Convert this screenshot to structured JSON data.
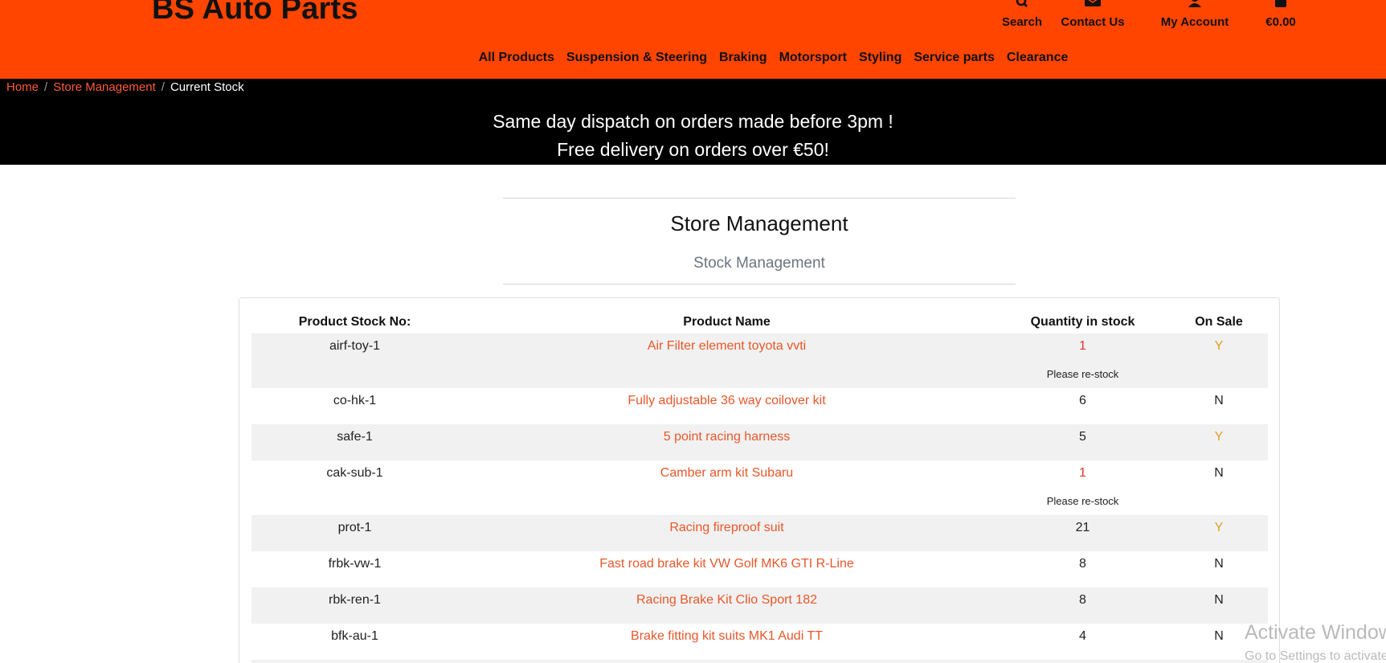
{
  "brand": "BS Auto Parts",
  "account_nav": [
    {
      "label": "Search",
      "icon": "search-icon"
    },
    {
      "label": "Contact Us",
      "icon": "envelope-icon"
    },
    {
      "label": "My Account",
      "icon": "user-icon"
    },
    {
      "label": "€0.00",
      "icon": "shopping-bag-icon"
    }
  ],
  "main_nav": [
    "All Products",
    "Suspension & Steering",
    "Braking",
    "Motorsport",
    "Styling",
    "Service parts",
    "Clearance"
  ],
  "breadcrumb": {
    "home": "Home",
    "section": "Store Management",
    "current": "Current Stock"
  },
  "banner": {
    "line1": "Same day dispatch on orders made before 3pm !",
    "line2": "Free delivery on orders over €50!"
  },
  "page": {
    "title": "Store Management",
    "subtitle": "Stock Management"
  },
  "table": {
    "headers": {
      "stock_no": "Product Stock No:",
      "name": "Product Name",
      "qty": "Quantity in stock",
      "sale": "On Sale"
    },
    "restock_note": "Please re-stock",
    "rows": [
      {
        "stock_no": "airf-toy-1",
        "name": "Air Filter element toyota vvti",
        "qty": "1",
        "sale": "Y"
      },
      {
        "stock_no": "co-hk-1",
        "name": "Fully adjustable 36 way coilover kit",
        "qty": "6",
        "sale": "N"
      },
      {
        "stock_no": "safe-1",
        "name": "5 point racing harness",
        "qty": "5",
        "sale": "Y"
      },
      {
        "stock_no": "cak-sub-1",
        "name": "Camber arm kit Subaru",
        "qty": "1",
        "sale": "N"
      },
      {
        "stock_no": "prot-1",
        "name": "Racing fireproof suit",
        "qty": "21",
        "sale": "Y"
      },
      {
        "stock_no": "frbk-vw-1",
        "name": "Fast road brake kit VW Golf MK6 GTI R-Line",
        "qty": "8",
        "sale": "N"
      },
      {
        "stock_no": "rbk-ren-1",
        "name": "Racing Brake Kit Clio Sport 182",
        "qty": "8",
        "sale": "N"
      },
      {
        "stock_no": "bfk-au-1",
        "name": "Brake fitting kit suits MK1 Audi TT",
        "qty": "4",
        "sale": "N"
      },
      {
        "stock_no": "",
        "name": "",
        "qty": "",
        "sale": ""
      }
    ]
  },
  "os_watermark": {
    "line1": "Activate Windows",
    "line2": "Go to Settings to activate Windows."
  },
  "colors": {
    "header": "#ff4500",
    "banner": "#000000",
    "link": "#e8572a",
    "low_stock": "#e8332a",
    "on_sale": "#e0a020"
  }
}
